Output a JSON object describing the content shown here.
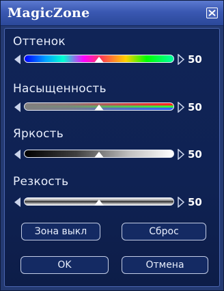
{
  "window": {
    "title": "MagicZone"
  },
  "sliders": [
    {
      "label": "Оттенок",
      "value": "50",
      "level": 0.5,
      "track": "hue"
    },
    {
      "label": "Насыщенность",
      "value": "50",
      "level": 0.5,
      "track": "saturation"
    },
    {
      "label": "Яркость",
      "value": "50",
      "level": 0.5,
      "track": "brightness"
    },
    {
      "label": "Резкость",
      "value": "50",
      "level": 0.5,
      "track": "sharpness"
    }
  ],
  "buttons": {
    "zone_off": "Зона выкл",
    "reset": "Сброс",
    "ok": "OK",
    "cancel": "Отмена"
  },
  "colors": {
    "dialog_bg": "#243a72",
    "title_bar": "#3a58b2",
    "panel_bg": "#102457",
    "text": "#e8eefc"
  },
  "icons": {
    "close": "close-x-icon",
    "decrease": "left-triangle-icon",
    "increase": "right-triangle-icon",
    "thumb": "triangle-thumb-icon"
  }
}
